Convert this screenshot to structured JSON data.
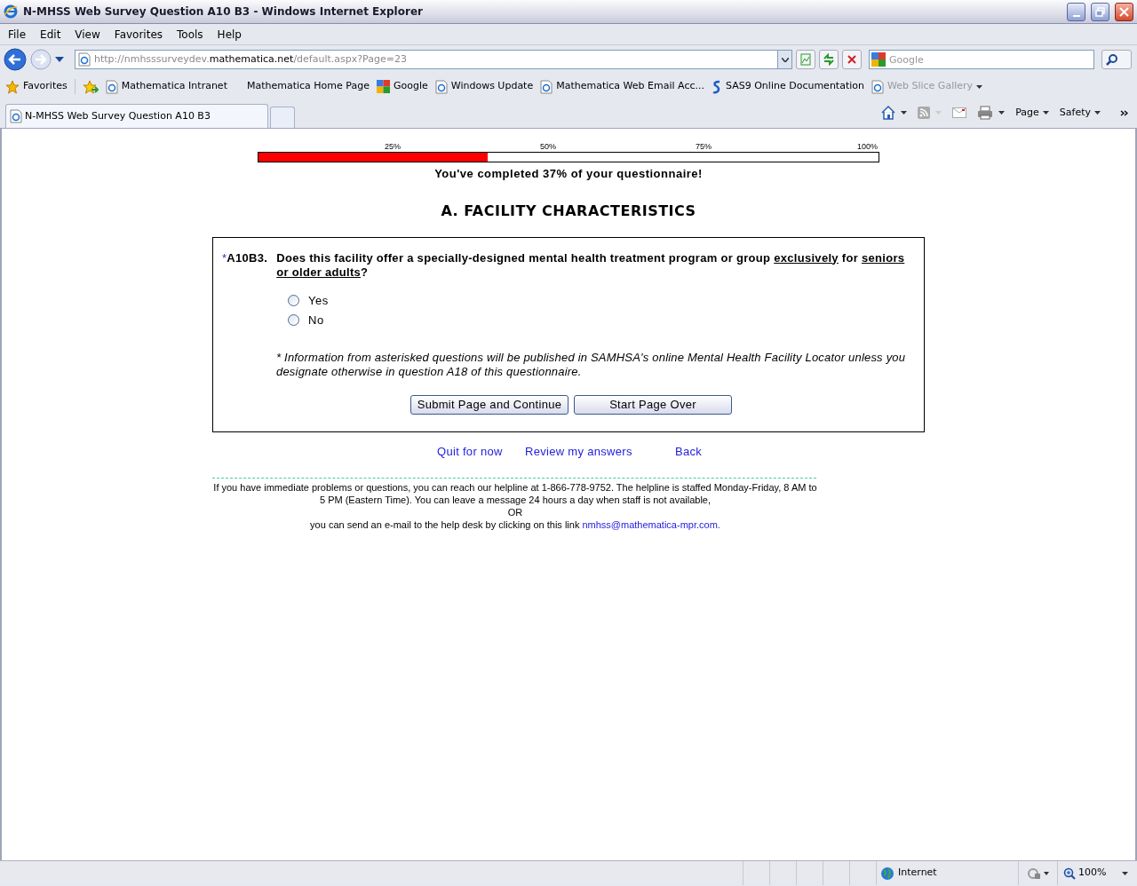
{
  "window": {
    "title": "N-MHSS Web Survey Question A10 B3 - Windows Internet Explorer"
  },
  "menu": [
    "File",
    "Edit",
    "View",
    "Favorites",
    "Tools",
    "Help"
  ],
  "address_bar": {
    "prefix": "http://nmhsssurveydev.",
    "domain": "mathematica.net",
    "path": "/default.aspx?Page=23"
  },
  "search": {
    "placeholder": "Google"
  },
  "favorites_bar": {
    "label": "Favorites",
    "items": [
      {
        "label": "Mathematica Intranet",
        "kind": "ie",
        "disabled": false
      },
      {
        "label": "Mathematica Home Page",
        "kind": "plain",
        "disabled": false
      },
      {
        "label": "Google",
        "kind": "google",
        "disabled": false
      },
      {
        "label": "Windows Update",
        "kind": "ie",
        "disabled": false
      },
      {
        "label": "Mathematica Web Email Acc...",
        "kind": "ie",
        "disabled": false
      },
      {
        "label": "SAS9 Online Documentation",
        "kind": "sas",
        "disabled": false
      },
      {
        "label": "Web Slice Gallery",
        "kind": "ie",
        "disabled": true
      }
    ]
  },
  "tabs": [
    {
      "label": "N-MHSS Web Survey Question A10 B3",
      "selected": true
    }
  ],
  "command_bar": [
    "Page",
    "Safety"
  ],
  "progress": {
    "ticks": [
      "25%",
      "50%",
      "75%",
      "100%"
    ],
    "level": 0.37,
    "message": "You've completed 37% of your questionnaire!"
  },
  "section_heading": "A. FACILITY CHARACTERISTICS",
  "question": {
    "marker": "*",
    "number": "A10B3.",
    "segments": [
      {
        "text": "Does this facility offer a specially-designed mental health treatment program or group ",
        "underline": false
      },
      {
        "text": "exclusively",
        "underline": true
      },
      {
        "text": " for ",
        "underline": false
      },
      {
        "text": "seniors or older adults",
        "underline": true
      },
      {
        "text": "?",
        "underline": false
      }
    ],
    "options": [
      {
        "label": "Yes",
        "selected": false
      },
      {
        "label": "No",
        "selected": false
      }
    ],
    "note": "* Information from asterisked questions will be published in SAMHSA's online Mental Health Facility Locator unless you designate otherwise in question A18 of this questionnaire."
  },
  "buttons": [
    "Submit Page and Continue",
    "Start Page Over"
  ],
  "nav_links": [
    "Quit for now",
    "Review my answers",
    "Back"
  ],
  "footer": {
    "lines": [
      "If you have immediate problems or questions, you can reach our helpline at 1-866-778-9752. The helpline is staffed Monday-Friday, 8 AM to 5 PM (Eastern Time). You can leave a message 24 hours a day when staff is not available,",
      "OR"
    ],
    "email_text": "you can send an e-mail to the help desk by clicking on this link",
    "email_link": "nmhss@mathematica-mpr.com."
  },
  "status_bar": {
    "zone": "Internet",
    "zoom": "100%"
  }
}
